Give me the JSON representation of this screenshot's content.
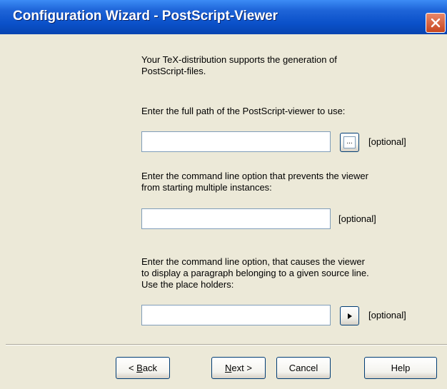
{
  "window": {
    "title": "Configuration Wizard - PostScript-Viewer"
  },
  "content": {
    "intro_line1": "Your TeX-distribution supports the generation of",
    "intro_line2": "PostScript-files.",
    "path_prompt": "Enter the full path of the PostScript-viewer to use:",
    "path_value": "",
    "browse_label": "...",
    "path_optional": "[optional]",
    "instance_prompt_line1": "Enter the command line option that prevents the viewer",
    "instance_prompt_line2": "from starting multiple instances:",
    "instance_value": "",
    "instance_optional": "[optional]",
    "source_prompt_line1": "Enter the command line option, that causes the viewer",
    "source_prompt_line2": "to display a paragraph belonging to a given source line.",
    "source_prompt_line3": "Use the place holders:",
    "source_value": "",
    "source_optional": "[optional]"
  },
  "buttons": {
    "back": {
      "mnemonic": "B",
      "rest": "ack",
      "prefix": "< "
    },
    "next": {
      "mnemonic": "N",
      "rest": "ext",
      "suffix": " >"
    },
    "cancel": "Cancel",
    "help": "Help"
  },
  "icons": {
    "close": "close-x-icon",
    "browse": "ellipsis-icon",
    "placeholder_menu": "triangle-right-icon"
  },
  "colors": {
    "titlebar": "#0A50C8",
    "dialog_bg": "#ECE9D8",
    "close_button": "#D7572F"
  }
}
